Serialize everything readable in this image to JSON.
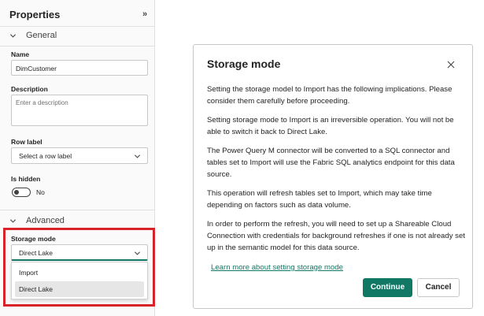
{
  "properties_panel": {
    "title": "Properties",
    "collapse_glyph": "»",
    "general_section": {
      "label": "General"
    },
    "name": {
      "label": "Name",
      "value": "DimCustomer"
    },
    "description": {
      "label": "Description",
      "placeholder": "Enter a description"
    },
    "row_label": {
      "label": "Row label",
      "placeholder": "Select a row label"
    },
    "is_hidden": {
      "label": "Is hidden",
      "state": "No"
    },
    "advanced_section": {
      "label": "Advanced"
    },
    "storage_mode": {
      "label": "Storage mode",
      "value": "Direct Lake",
      "options": [
        "Import",
        "Direct Lake"
      ]
    }
  },
  "dialog": {
    "title": "Storage mode",
    "paragraphs": [
      "Setting the storage model to Import has the following implications. Please consider them carefully before proceeding.",
      "Setting storage mode to Import is an irreversible operation. You will not be able to switch it back to Direct Lake.",
      "The Power Query M connector will be converted to a SQL connector and tables set to Import will use the Fabric SQL analytics endpoint for this data source.",
      "This operation will refresh tables set to Import, which may take time depending on factors such as data volume.",
      "In order to perform the refresh, you will need to set up a Shareable Cloud Connection with credentials for background refreshes if one is not already set up in the semantic model for this data source."
    ],
    "link": "Learn more about setting storage mode",
    "continue_label": "Continue",
    "cancel_label": "Cancel"
  },
  "icons": {
    "section_chevron": "chevron-down-icon",
    "select_chevron": "chevron-down-icon",
    "close": "close-icon"
  },
  "colors": {
    "accent": "#117865",
    "highlight": "#d9232a"
  }
}
